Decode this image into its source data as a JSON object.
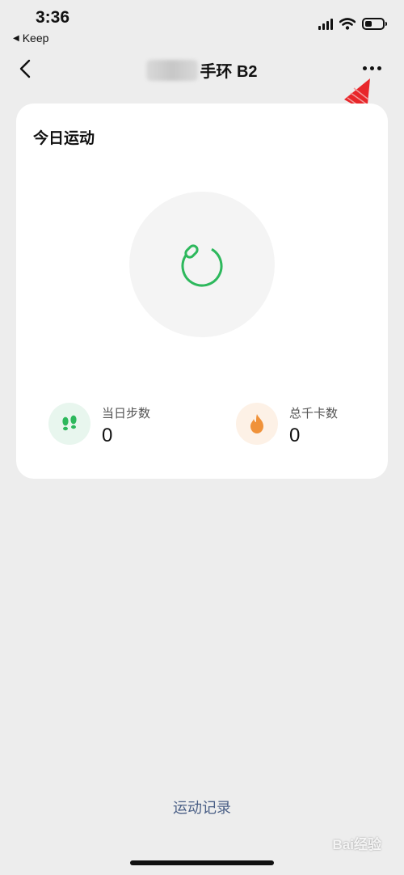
{
  "status_bar": {
    "time": "3:36",
    "back_app": "Keep",
    "back_arrow_glyph": "◀",
    "icons": [
      "signal-icon",
      "wifi-icon",
      "battery-icon"
    ]
  },
  "nav": {
    "back_icon": "chevron-left-icon",
    "title_suffix": "手环 B2",
    "more_icon": "more-dots-icon"
  },
  "card": {
    "title": "今日运动",
    "ring_color": "#2db85c",
    "progress_icon": "activity-ring-icon",
    "stats": [
      {
        "icon": "footprints-icon",
        "label": "当日步数",
        "value": "0",
        "icon_bg": "#e8f6ee",
        "icon_color": "#2db85c"
      },
      {
        "icon": "flame-icon",
        "label": "总千卡数",
        "value": "0",
        "icon_bg": "#fdf1e6",
        "icon_color": "#f0923a"
      }
    ]
  },
  "footer": {
    "history_link": "运动记录"
  },
  "watermark": "Bai经验",
  "annotation": {
    "color": "#e8262a"
  }
}
